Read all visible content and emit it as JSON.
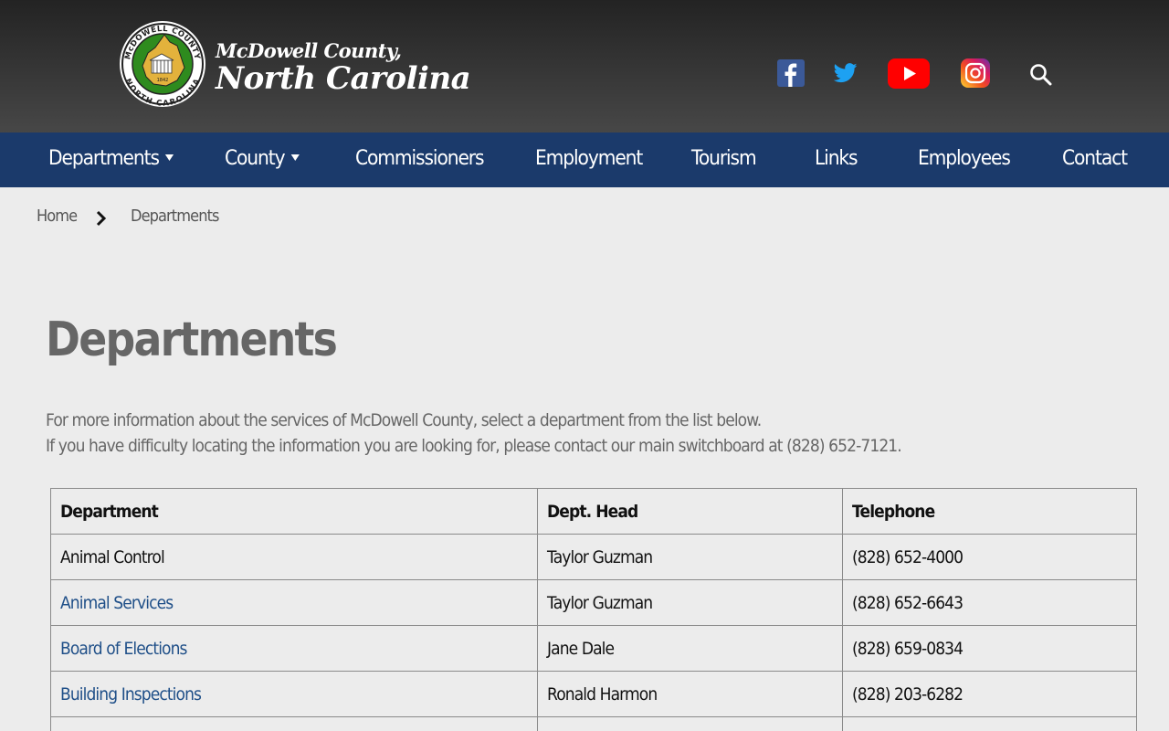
{
  "header": {
    "seal_text_top": "McDOWELL COUNTY",
    "seal_text_bottom": "NORTH CAROLINA",
    "seal_year": "1842",
    "logo_line1": "McDowell County,",
    "logo_line2": "North Carolina",
    "social_icons": [
      "facebook-icon",
      "twitter-icon",
      "youtube-icon",
      "instagram-icon",
      "search-icon"
    ]
  },
  "nav": {
    "items": [
      {
        "label": "Departments",
        "dropdown": true
      },
      {
        "label": "County",
        "dropdown": true
      },
      {
        "label": "Commissioners",
        "dropdown": false
      },
      {
        "label": "Employment",
        "dropdown": false
      },
      {
        "label": "Tourism",
        "dropdown": false
      },
      {
        "label": "Links",
        "dropdown": false
      },
      {
        "label": "Employees",
        "dropdown": false
      },
      {
        "label": "Contact",
        "dropdown": false
      }
    ]
  },
  "breadcrumb": {
    "home": "Home",
    "current": "Departments"
  },
  "main": {
    "title": "Departments",
    "intro_line1": "For more information about the services of McDowell County, select a department from the list below.",
    "intro_line2": "If you have difficulty locating the information you are looking for, please contact our main switchboard at (828) 652-7121."
  },
  "table": {
    "headers": [
      "Department",
      "Dept. Head",
      "Telephone"
    ],
    "rows": [
      {
        "department": "Animal Control",
        "head": "Taylor Guzman",
        "phone": "(828) 652-4000",
        "is_link": false
      },
      {
        "department": "Animal Services",
        "head": "Taylor Guzman",
        "phone": "(828) 652-6643",
        "is_link": true
      },
      {
        "department": "Board of Elections",
        "head": "Jane Dale",
        "phone": "(828) 659-0834",
        "is_link": true
      },
      {
        "department": "Building Inspections",
        "head": "Ronald Harmon",
        "phone": "(828) 203-6282",
        "is_link": true
      }
    ]
  },
  "colors": {
    "nav_bg": "#1b3a6b",
    "link": "#1f4f88",
    "page_bg": "#ececec",
    "seal_green": "#2e8b1e",
    "seal_gold": "#e3b23c"
  }
}
